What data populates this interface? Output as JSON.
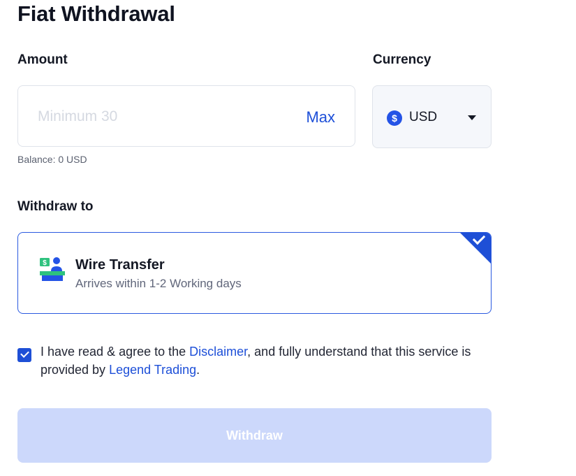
{
  "page": {
    "title": "Fiat Withdrawal"
  },
  "amount": {
    "label": "Amount",
    "value": "",
    "placeholder": "Minimum 30",
    "max_label": "Max",
    "balance": "Balance: 0 USD"
  },
  "currency": {
    "label": "Currency",
    "selected": "USD",
    "coin_symbol": "$",
    "icon": "dollar-coin-icon"
  },
  "withdraw_to": {
    "label": "Withdraw to",
    "method": {
      "title": "Wire Transfer",
      "subtitle": "Arrives within 1-2 Working days",
      "icon": "wire-transfer-icon",
      "selected": true
    }
  },
  "agreement": {
    "checked": true,
    "text_1": "I have read & agree to the ",
    "link_1": "Disclaimer",
    "text_2": ", and fully understand that this service is provided by ",
    "link_2": "Legend Trading",
    "text_3": "."
  },
  "actions": {
    "withdraw_label": "Withdraw"
  },
  "colors": {
    "accent": "#1e4fd6",
    "button_disabled": "#ccd8fb",
    "icon_green": "#2ec27e"
  }
}
